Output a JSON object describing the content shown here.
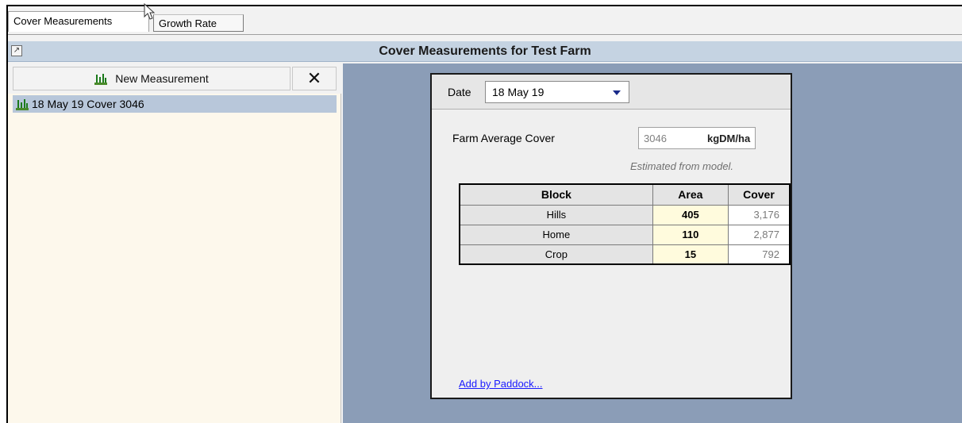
{
  "tabs": [
    {
      "label": "Cover Measurements",
      "active": true
    },
    {
      "label": "Growth Rate",
      "active": false
    }
  ],
  "header": {
    "title": "Cover Measurements for Test Farm",
    "pin_icon": "pin-icon"
  },
  "left_panel": {
    "new_button_label": "New Measurement",
    "delete_button_label": "✕",
    "items": [
      {
        "label": "18 May 19 Cover 3046",
        "selected": true
      }
    ]
  },
  "detail": {
    "date_label": "Date",
    "date_value": "18 May 19",
    "farm_average_label": "Farm Average Cover",
    "farm_average_value": "3046",
    "farm_average_unit": "kgDM/ha",
    "estimated_note": "Estimated from model.",
    "table": {
      "headers": [
        "Block",
        "Area",
        "Cover"
      ],
      "rows": [
        {
          "block": "Hills",
          "area": "405",
          "cover": "3,176"
        },
        {
          "block": "Home",
          "area": "110",
          "cover": "2,877"
        },
        {
          "block": "Crop",
          "area": "15",
          "cover": "792"
        }
      ]
    },
    "add_link": "Add by Paddock..."
  },
  "colors": {
    "header_bg": "#c5d3e2",
    "right_bg": "#8b9db7",
    "left_bg": "#fdf8ec",
    "selected_item": "#b8c7da",
    "area_cell": "#fffbdd",
    "link": "#1a1aff"
  }
}
